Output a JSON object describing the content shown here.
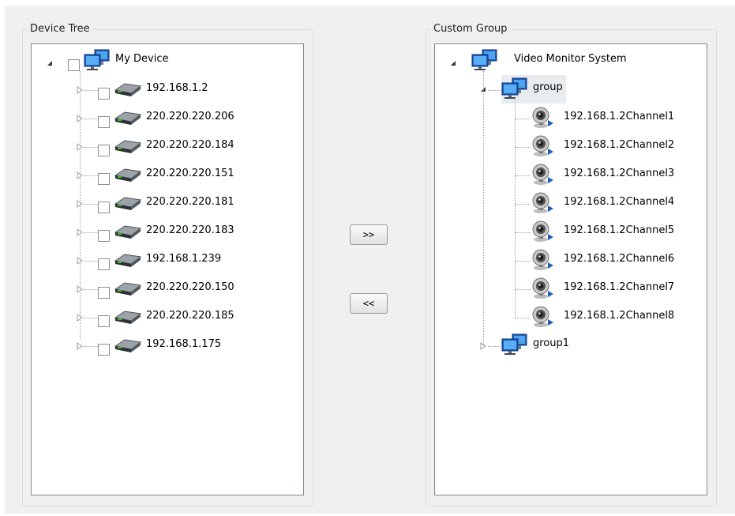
{
  "device_tree": {
    "title": "Device Tree",
    "root": {
      "label": "My Device",
      "icon": "computer-network-icon"
    },
    "devices": [
      {
        "label": "192.168.1.2"
      },
      {
        "label": "220.220.220.206"
      },
      {
        "label": "220.220.220.184"
      },
      {
        "label": "220.220.220.151"
      },
      {
        "label": "220.220.220.181"
      },
      {
        "label": "220.220.220.183"
      },
      {
        "label": "192.168.1.239"
      },
      {
        "label": "220.220.220.150"
      },
      {
        "label": "220.220.220.185"
      },
      {
        "label": "192.168.1.175"
      }
    ]
  },
  "buttons": {
    "add": ">>",
    "remove": "<<"
  },
  "custom_group": {
    "title": "Custom Group",
    "root": {
      "label": "Video Monitor System"
    },
    "groups": [
      {
        "label": "group",
        "expanded": true,
        "channels": [
          {
            "label": "192.168.1.2Channel1"
          },
          {
            "label": "192.168.1.2Channel2"
          },
          {
            "label": "192.168.1.2Channel3"
          },
          {
            "label": "192.168.1.2Channel4"
          },
          {
            "label": "192.168.1.2Channel5"
          },
          {
            "label": "192.168.1.2Channel6"
          },
          {
            "label": "192.168.1.2Channel7"
          },
          {
            "label": "192.168.1.2Channel8"
          }
        ]
      },
      {
        "label": "group1",
        "expanded": false,
        "channels": []
      }
    ]
  },
  "colors": {
    "tree_border": "#828790",
    "selection": "#e9ecef",
    "background": "#f0f0f0"
  }
}
